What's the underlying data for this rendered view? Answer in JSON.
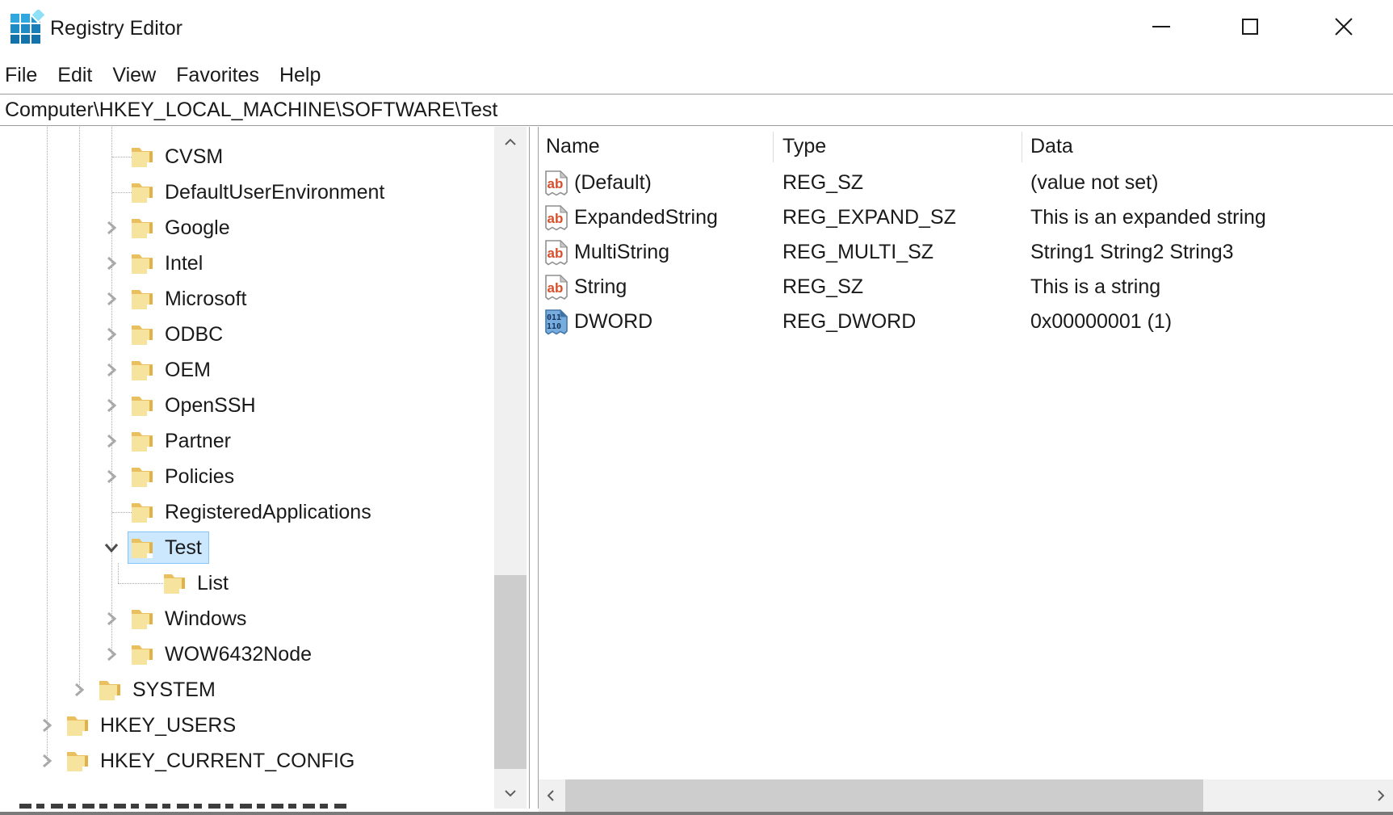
{
  "window": {
    "title": "Registry Editor",
    "controls": {
      "minimize_icon": "minimize-icon",
      "maximize_icon": "maximize-icon",
      "close_icon": "close-icon"
    },
    "app_icon": "registry-editor-icon"
  },
  "menubar": {
    "items": [
      "File",
      "Edit",
      "View",
      "Favorites",
      "Help"
    ]
  },
  "addressbar": {
    "value": "Computer\\HKEY_LOCAL_MACHINE\\SOFTWARE\\Test"
  },
  "tree": {
    "items": [
      {
        "label": "CVSM",
        "level": 2,
        "expander": "none",
        "selected": false
      },
      {
        "label": "DefaultUserEnvironment",
        "level": 2,
        "expander": "none",
        "selected": false
      },
      {
        "label": "Google",
        "level": 2,
        "expander": "collapsed",
        "selected": false
      },
      {
        "label": "Intel",
        "level": 2,
        "expander": "collapsed",
        "selected": false
      },
      {
        "label": "Microsoft",
        "level": 2,
        "expander": "collapsed",
        "selected": false
      },
      {
        "label": "ODBC",
        "level": 2,
        "expander": "collapsed",
        "selected": false
      },
      {
        "label": "OEM",
        "level": 2,
        "expander": "collapsed",
        "selected": false
      },
      {
        "label": "OpenSSH",
        "level": 2,
        "expander": "collapsed",
        "selected": false
      },
      {
        "label": "Partner",
        "level": 2,
        "expander": "collapsed",
        "selected": false
      },
      {
        "label": "Policies",
        "level": 2,
        "expander": "collapsed",
        "selected": false
      },
      {
        "label": "RegisteredApplications",
        "level": 2,
        "expander": "none",
        "selected": false
      },
      {
        "label": "Test",
        "level": 2,
        "expander": "expanded",
        "selected": true
      },
      {
        "label": "List",
        "level": 3,
        "expander": "none",
        "selected": false
      },
      {
        "label": "Windows",
        "level": 2,
        "expander": "collapsed",
        "selected": false
      },
      {
        "label": "WOW6432Node",
        "level": 2,
        "expander": "collapsed",
        "selected": false
      },
      {
        "label": "SYSTEM",
        "level": 1,
        "expander": "collapsed",
        "selected": false
      },
      {
        "label": "HKEY_USERS",
        "level": 0,
        "expander": "collapsed",
        "selected": false
      },
      {
        "label": "HKEY_CURRENT_CONFIG",
        "level": 0,
        "expander": "collapsed",
        "selected": false
      }
    ]
  },
  "list": {
    "columns": [
      "Name",
      "Type",
      "Data"
    ],
    "rows": [
      {
        "icon": "string-value-icon",
        "name": "(Default)",
        "type": "REG_SZ",
        "data": "(value not set)"
      },
      {
        "icon": "string-value-icon",
        "name": "ExpandedString",
        "type": "REG_EXPAND_SZ",
        "data": "This is an expanded string"
      },
      {
        "icon": "string-value-icon",
        "name": "MultiString",
        "type": "REG_MULTI_SZ",
        "data": "String1 String2 String3"
      },
      {
        "icon": "string-value-icon",
        "name": "String",
        "type": "REG_SZ",
        "data": "This is a string"
      },
      {
        "icon": "dword-value-icon",
        "name": "DWORD",
        "type": "REG_DWORD",
        "data": "0x00000001 (1)"
      }
    ]
  },
  "colors": {
    "selection_bg": "#cce8ff",
    "selection_border": "#86c5f7",
    "folder": "#f6e49e",
    "string_icon_text": "#d8502b",
    "dword_icon_bg": "#76acde",
    "scrollbar_track": "#f0f0f0",
    "scrollbar_thumb": "#cdcdcd"
  }
}
